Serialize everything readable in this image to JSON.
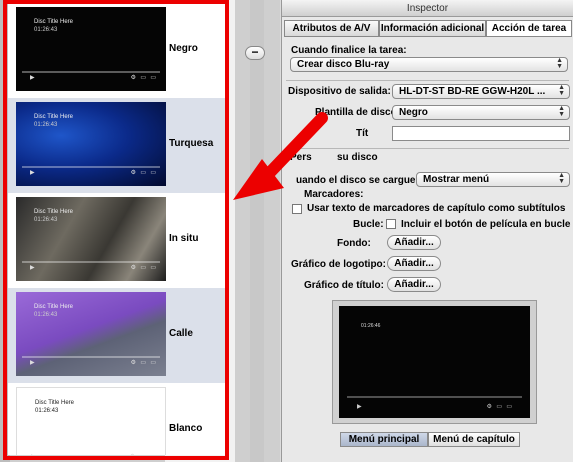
{
  "background_window": {
    "minus_button": "−"
  },
  "templates": [
    {
      "name": "Negro",
      "thumb_title": "Disc Title Here",
      "thumb_time": "01:26:43",
      "style": "negro",
      "selected": false
    },
    {
      "name": "Turquesa",
      "thumb_title": "Disc Title Here",
      "thumb_time": "01:26:43",
      "style": "turquesa",
      "selected": true
    },
    {
      "name": "In situ",
      "thumb_title": "Disc Title Here",
      "thumb_time": "01:26:43",
      "style": "insitu",
      "selected": false
    },
    {
      "name": "Calle",
      "thumb_title": "Disc Title Here",
      "thumb_time": "01:26:43",
      "style": "calle",
      "selected": true
    },
    {
      "name": "Blanco",
      "thumb_title": "Disc Title Here",
      "thumb_time": "01:26:43",
      "style": "blanco",
      "selected": false
    }
  ],
  "inspector": {
    "title": "Inspector",
    "tabs": [
      {
        "label": "Atributos de A/V",
        "active": false
      },
      {
        "label": "Información adicional",
        "active": false
      },
      {
        "label": "Acción de tarea",
        "active": true
      }
    ],
    "when_finished_label": "Cuando finalice la tarea:",
    "when_finished_value": "Crear disco Blu-ray",
    "output_device_label": "Dispositivo de salida:",
    "output_device_value": "HL-DT-ST BD-RE  GGW-H20L ...",
    "disc_template_label": "Plantilla de disco:",
    "disc_template_value": "Negro",
    "title_label": "Tít",
    "customize_label": "Pers",
    "customize_label_tail": "su disco",
    "on_load_label": "uando el disco se cargue:",
    "on_load_value": "Mostrar menú",
    "markers_label": "Marcadores:",
    "markers_checkbox_label": "Usar texto de marcadores de capítulo como subtítulos",
    "loop_label": "Bucle:",
    "loop_checkbox_label": "Incluir el botón de película en bucle",
    "background_label": "Fondo:",
    "logo_label": "Gráfico de logotipo:",
    "title_graphic_label": "Gráfico de título:",
    "add_button": "Añadir...",
    "preview_time": "01:26:46",
    "segments": [
      {
        "label": "Menú principal",
        "active": true
      },
      {
        "label": "Menú de capítulo",
        "active": false
      }
    ]
  },
  "colors": {
    "highlight_frame": "#ec0000",
    "arrow": "#ec0000"
  }
}
